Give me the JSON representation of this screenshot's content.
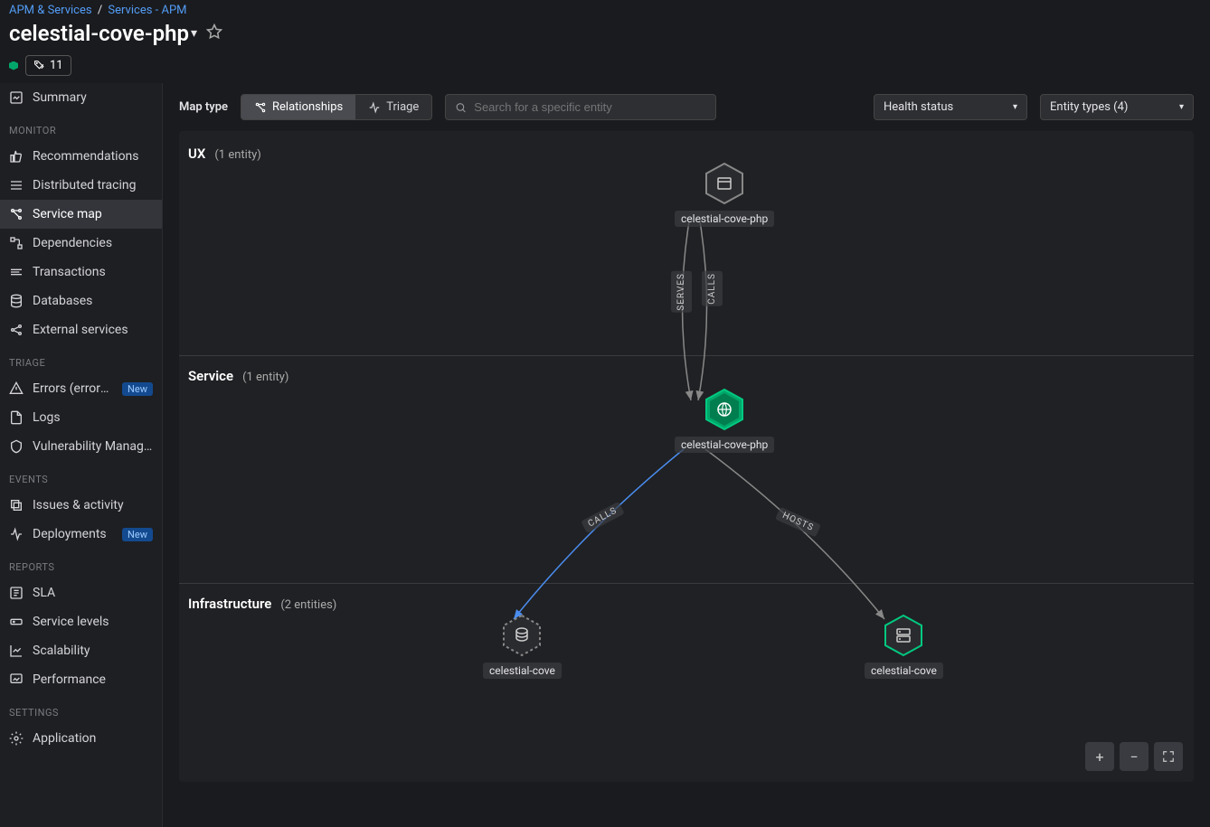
{
  "breadcrumb": {
    "part1": "APM & Services",
    "part2": "Services - APM"
  },
  "page": {
    "title": "celestial-cove-php",
    "tags_count": "11"
  },
  "sidebar": {
    "summary": "Summary",
    "groups": [
      {
        "header": "MONITOR",
        "items": [
          {
            "label": "Recommendations",
            "icon": "thumbs-up"
          },
          {
            "label": "Distributed tracing",
            "icon": "trace"
          },
          {
            "label": "Service map",
            "icon": "map",
            "active": true
          },
          {
            "label": "Dependencies",
            "icon": "deps"
          },
          {
            "label": "Transactions",
            "icon": "transactions"
          },
          {
            "label": "Databases",
            "icon": "database"
          },
          {
            "label": "External services",
            "icon": "external"
          }
        ]
      },
      {
        "header": "TRIAGE",
        "items": [
          {
            "label": "Errors (errors inbo",
            "icon": "errors",
            "badge": "New"
          },
          {
            "label": "Logs",
            "icon": "logs"
          },
          {
            "label": "Vulnerability Manage…",
            "icon": "shield"
          }
        ]
      },
      {
        "header": "EVENTS",
        "items": [
          {
            "label": "Issues & activity",
            "icon": "issues"
          },
          {
            "label": "Deployments",
            "icon": "deploy",
            "badge": "New"
          }
        ]
      },
      {
        "header": "REPORTS",
        "items": [
          {
            "label": "SLA",
            "icon": "sla"
          },
          {
            "label": "Service levels",
            "icon": "levels"
          },
          {
            "label": "Scalability",
            "icon": "scalability"
          },
          {
            "label": "Performance",
            "icon": "performance"
          }
        ]
      },
      {
        "header": "SETTINGS",
        "items": [
          {
            "label": "Application",
            "icon": "gear"
          }
        ]
      }
    ]
  },
  "toolbar": {
    "map_type_label": "Map type",
    "relationships": "Relationships",
    "triage": "Triage",
    "search_placeholder": "Search for a specific entity",
    "health_status": "Health status",
    "entity_types": "Entity types (4)"
  },
  "map": {
    "sections": [
      {
        "name": "UX",
        "count": "(1 entity)"
      },
      {
        "name": "Service",
        "count": "(1 entity)"
      },
      {
        "name": "Infrastructure",
        "count": "(2 entities)"
      }
    ],
    "nodes": {
      "ux": "celestial-cove-php",
      "service": "celestial-cove-php",
      "infra1": "celestial-cove",
      "infra2": "celestial-cove"
    },
    "edges": {
      "serves": "SERVES",
      "calls1": "CALLS",
      "calls2": "CALLS",
      "hosts": "HOSTS"
    }
  }
}
